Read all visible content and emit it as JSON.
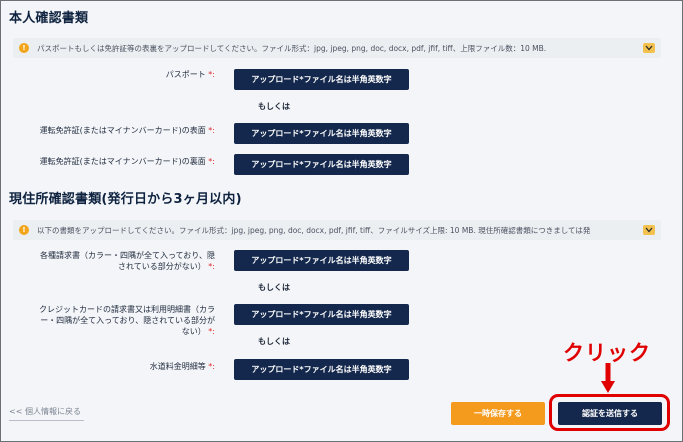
{
  "identity": {
    "title": "本人確認書類",
    "notice": "パスポートもしくは免許証等の表裏をアップロードしてください。ファイル形式：jpg, jpeg, png, doc, docx, pdf, jfif, tiff、上限ファイル数：10 MB.",
    "rows": [
      {
        "label": "パスポート",
        "required": "*:",
        "button": "アップロード*ファイル名は半角英数字"
      },
      {
        "label": "運転免許証(またはマイナンバーカード)の表面",
        "required": "*:",
        "button": "アップロード*ファイル名は半角英数字"
      },
      {
        "label": "運転免許証(またはマイナンバーカード)の裏面",
        "required": "*:",
        "button": "アップロード*ファイル名は半角英数字"
      }
    ],
    "or_text": "もしくは"
  },
  "address": {
    "title": "現住所確認書類(発行日から3ヶ月以内)",
    "notice": "以下の書類をアップロードしてください。ファイル形式：jpg, jpeg, png, doc, docx, pdf, jfif, tiff、ファイルサイズ上限: 10 MB. 現住所確認書類につきましては発",
    "rows": [
      {
        "label_line1": "各種請求書（カラー・四隅が全て入っており、隠",
        "label_line2": "されている部分がない）",
        "required": "*:",
        "button": "アップロード*ファイル名は半角英数字"
      },
      {
        "label_line1": "クレジットカードの請求書又は利用明細書（カラ",
        "label_line2": "ー・四隅が全て入っており、隠されている部分が",
        "label_line3": "ない）",
        "required": "*:",
        "button": "アップロード*ファイル名は半角英数字"
      },
      {
        "label": "水道料金明細等",
        "required": "*:",
        "button": "アップロード*ファイル名は半角英数字"
      }
    ],
    "or_text": "もしくは"
  },
  "footer": {
    "back_label": "<< 個人情報に戻る",
    "save_label": "一時保存する",
    "submit_label": "認証を送信する"
  },
  "annotation": {
    "click_label": "クリック",
    "color": "#e00000"
  },
  "colors": {
    "navy": "#14284d",
    "orange": "#f49b1e",
    "required": "#e02b2b"
  }
}
